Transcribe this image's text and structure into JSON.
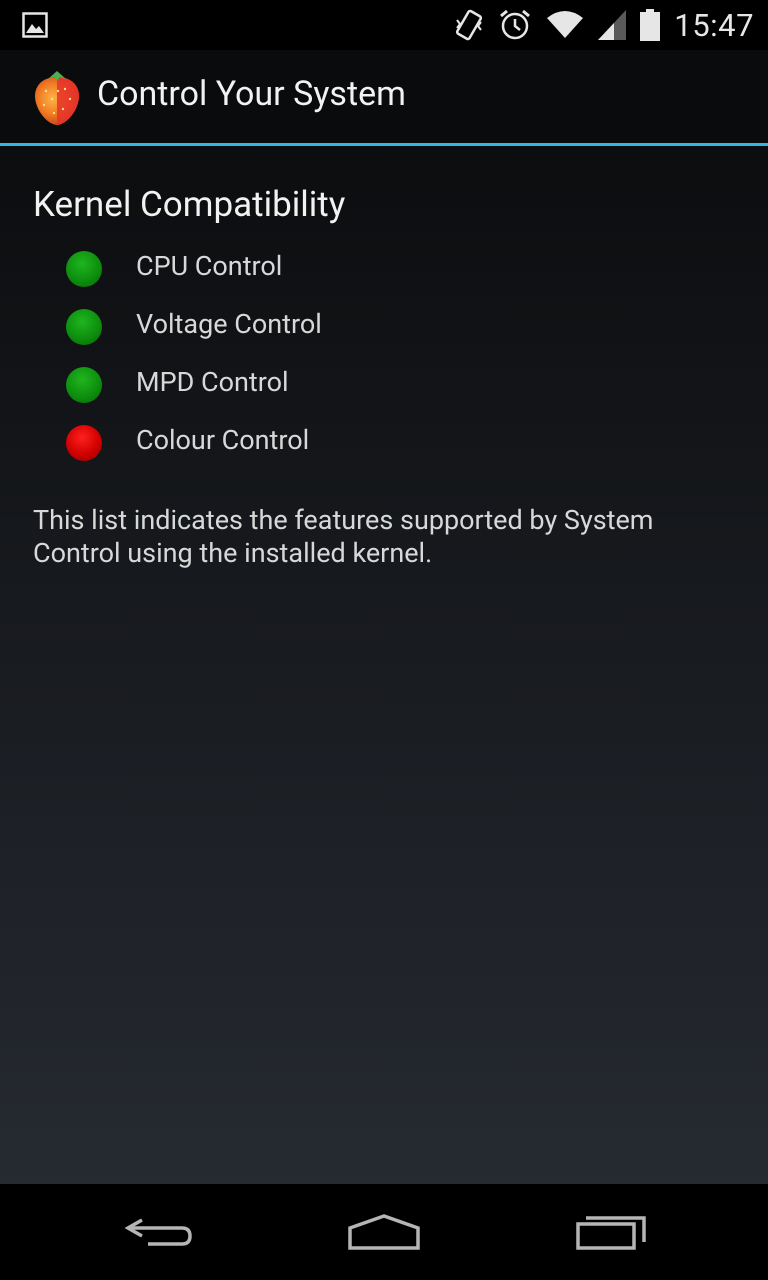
{
  "status_bar": {
    "time": "15:47",
    "icons": [
      "image-notification-icon",
      "vibrate-icon",
      "alarm-icon",
      "wifi-icon",
      "signal-icon",
      "battery-icon"
    ]
  },
  "action_bar": {
    "title": "Control Your System",
    "app_icon": "strawberry-icon",
    "accent_color": "#33b5e5"
  },
  "main": {
    "section_title": "Kernel Compatibility",
    "features": [
      {
        "label": "CPU Control",
        "status": "supported",
        "color": "#0e8f0e"
      },
      {
        "label": "Voltage Control",
        "status": "supported",
        "color": "#0e8f0e"
      },
      {
        "label": "MPD Control",
        "status": "supported",
        "color": "#0e8f0e"
      },
      {
        "label": "Colour Control",
        "status": "unsupported",
        "color": "#d00000"
      }
    ],
    "description": "This list indicates the features supported by System Control using the installed kernel."
  },
  "nav_bar": {
    "buttons": [
      "back-icon",
      "home-icon",
      "recents-icon"
    ]
  }
}
